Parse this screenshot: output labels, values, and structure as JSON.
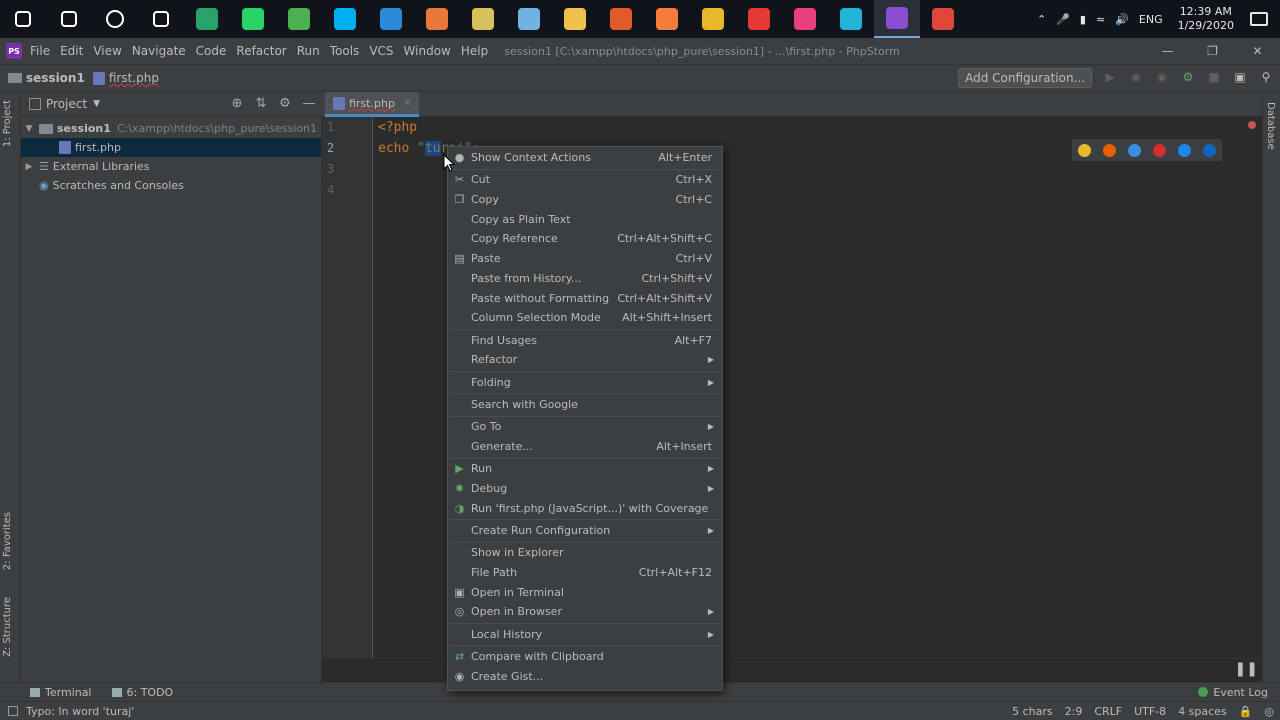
{
  "taskbar": {
    "tray": {
      "lang": "ENG",
      "time": "12:39 AM",
      "date": "1/29/2020"
    },
    "apps": [
      {
        "name": "windows-start",
        "color": "#ffffff"
      },
      {
        "name": "search",
        "color": "#ffffff"
      },
      {
        "name": "cortana",
        "color": "#ffffff"
      },
      {
        "name": "task-view",
        "color": "#ffffff"
      },
      {
        "name": "app-green-e",
        "color": "#29a36a"
      },
      {
        "name": "whatsapp",
        "color": "#25d366"
      },
      {
        "name": "app-green-ring",
        "color": "#4caf50"
      },
      {
        "name": "skype",
        "color": "#00aff0"
      },
      {
        "name": "vscode",
        "color": "#2b8bd8"
      },
      {
        "name": "app-orange",
        "color": "#e8783a"
      },
      {
        "name": "app-yellow",
        "color": "#d6c25a"
      },
      {
        "name": "app-cube",
        "color": "#6fb3e0"
      },
      {
        "name": "file-explorer",
        "color": "#f0c24d"
      },
      {
        "name": "app-multicolor",
        "color": "#e05a2b"
      },
      {
        "name": "xampp",
        "color": "#f57c3a"
      },
      {
        "name": "chrome",
        "color": "#e9b82a"
      },
      {
        "name": "app-red-bolt",
        "color": "#e53935"
      },
      {
        "name": "intellij",
        "color": "#e8407a"
      },
      {
        "name": "webstorm",
        "color": "#1fb4d8"
      },
      {
        "name": "phpstorm",
        "color": "#8c4ed0"
      },
      {
        "name": "app-red-s",
        "color": "#e0453a"
      }
    ]
  },
  "menubar": {
    "logo": "PS",
    "items": [
      "File",
      "Edit",
      "View",
      "Navigate",
      "Code",
      "Refactor",
      "Run",
      "Tools",
      "VCS",
      "Window",
      "Help"
    ],
    "title": "session1 [C:\\xampp\\htdocs\\php_pure\\session1] - ...\\first.php - PhpStorm"
  },
  "navbar": {
    "project": "session1",
    "file": "first.php",
    "add_config": "Add Configuration..."
  },
  "left_strip": {
    "project_tab": "1: Project",
    "favorites_tab": "2: Favorites",
    "structure_tab": "Z: Structure"
  },
  "right_strip": {
    "database_tab": "Database"
  },
  "project_panel": {
    "title": "Project",
    "tree": [
      {
        "label": "session1",
        "path": "C:\\xampp\\htdocs\\php_pure\\session1"
      },
      {
        "label": "first.php"
      },
      {
        "label": "External Libraries"
      },
      {
        "label": "Scratches and Consoles"
      }
    ]
  },
  "editor": {
    "tab": "first.php",
    "line_numbers": [
      "1",
      "2",
      "3",
      "4"
    ],
    "line1": "<?php",
    "line2_kw": "echo",
    "line2_q": " \"",
    "line2_sel": "tu",
    "line2_rest": "raj\";"
  },
  "context_menu": {
    "items": [
      {
        "label": "Show Context Actions",
        "shortcut": "Alt+Enter",
        "icon": "bulb-icon"
      },
      {
        "label": "Cut",
        "shortcut": "Ctrl+X",
        "icon": "scissors-icon"
      },
      {
        "label": "Copy",
        "shortcut": "Ctrl+C",
        "icon": "copy-icon"
      },
      {
        "label": "Copy as Plain Text",
        "shortcut": ""
      },
      {
        "label": "Copy Reference",
        "shortcut": "Ctrl+Alt+Shift+C"
      },
      {
        "label": "Paste",
        "shortcut": "Ctrl+V",
        "icon": "clipboard-icon"
      },
      {
        "label": "Paste from History...",
        "shortcut": "Ctrl+Shift+V"
      },
      {
        "label": "Paste without Formatting",
        "shortcut": "Ctrl+Alt+Shift+V"
      },
      {
        "label": "Column Selection Mode",
        "shortcut": "Alt+Shift+Insert"
      },
      {
        "label": "Find Usages",
        "shortcut": "Alt+F7"
      },
      {
        "label": "Refactor",
        "shortcut": "",
        "submenu": true
      },
      {
        "label": "Folding",
        "shortcut": "",
        "submenu": true
      },
      {
        "label": "Search with Google",
        "shortcut": ""
      },
      {
        "label": "Go To",
        "shortcut": "",
        "submenu": true
      },
      {
        "label": "Generate...",
        "shortcut": "Alt+Insert"
      },
      {
        "label": "Run",
        "shortcut": "",
        "submenu": true,
        "icon": "run-icon"
      },
      {
        "label": "Debug",
        "shortcut": "",
        "submenu": true,
        "icon": "debug-icon"
      },
      {
        "label": "Run 'first.php (JavaScript...)' with Coverage",
        "shortcut": "",
        "icon": "coverage-icon"
      },
      {
        "label": "Create Run Configuration",
        "shortcut": "",
        "submenu": true
      },
      {
        "label": "Show in Explorer",
        "shortcut": ""
      },
      {
        "label": "File Path",
        "shortcut": "Ctrl+Alt+F12"
      },
      {
        "label": "Open in Terminal",
        "shortcut": "",
        "icon": "terminal-icon"
      },
      {
        "label": "Open in Browser",
        "shortcut": "",
        "submenu": true,
        "icon": "globe-icon"
      },
      {
        "label": "Local History",
        "shortcut": "",
        "submenu": true
      },
      {
        "label": "Compare with Clipboard",
        "shortcut": "",
        "icon": "compare-icon"
      },
      {
        "label": "Create Gist...",
        "shortcut": "",
        "icon": "github-icon"
      }
    ]
  },
  "bottom_tools": {
    "terminal": "Terminal",
    "todo": "6: TODO",
    "event_log": "Event Log"
  },
  "status": {
    "message": "Typo: In word 'turaj'",
    "chars": "5 chars",
    "position": "2:9",
    "line_sep": "CRLF",
    "encoding": "UTF-8",
    "indent": "4 spaces"
  },
  "colors": {
    "accent": "#4a88c7",
    "selection": "#214283",
    "keyword": "#cc7832",
    "string": "#6a8759"
  }
}
